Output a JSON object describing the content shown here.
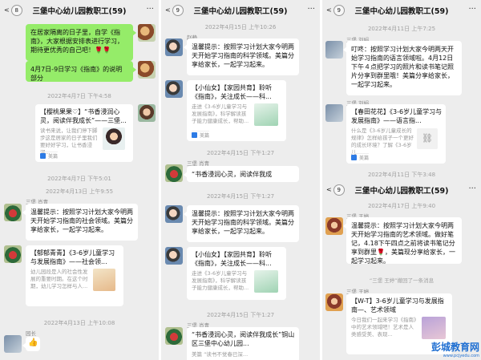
{
  "group_title": "三堡中心幼儿园教职工(59)",
  "colors": {
    "accent_green": "#95ec69",
    "panel_bg": "#ededed",
    "link_blue": "#576b95"
  },
  "panel1": {
    "back_count": "8",
    "msg1": "在居家隔离的日子里，自学《指南》，大家根据安排表进行学习，期待更优秀的自己吧！🌹🌹",
    "msg2": "4月7日-9日学习《指南》的说明部分",
    "ts1": "2022年4月7日 下午4:58",
    "card1_title": "【樱桃果果♡】“书香浸润心灵，阅读伴我成长”——三堡...",
    "card1_desc": "读书来说，让我们停下脚步这是居家的日子里我们要好好学习，让书香浸润...",
    "card1_source": "美篇",
    "ts2": "2022年4月7日 下午5:01",
    "ts3": "2022年4月13日 上午9:55",
    "sender1": "三堡 肖青",
    "msg3": "温馨提示：按照学习计划大家今明两天开始学习指南的社会领域。美篇分享给家长，一起学习起来。",
    "card2_title": "【郁郁青青】《3-6岁儿童学习与发展指南》——社会领...",
    "card2_desc": "幼儿园段是人的社会性发展的重要时期。在这个时期，幼儿学习怎样与人...",
    "ts4": "2022年4月13日 上午10:08",
    "sender2": "园长"
  },
  "panel2": {
    "back_count": "9",
    "ts1": "2022年4月15日 上午10:26",
    "sender1": "赵静",
    "msg1": "温馨提示：按照学习计划大家今明两天开始学习指南的科学领域。美篇分享给家长，一起学习起来。",
    "card1_title": "【小仙女】【家园共育】聆听《指南》，关注成长——科...",
    "card1_desc": "走进《3-6岁儿童学习与发展指南》，科学解读孩子能力健康成长，帮助...",
    "card1_source": "美篇",
    "ts2": "2022年4月15日 下午1:27",
    "sender2": "三堡 肖青",
    "msg2": "“书香浸润心灵，阅读伴我成",
    "ts3": "2022年4月15日 下午1:27",
    "msg3": "温馨提示：按照学习计划大家今明两天开始学习指南的科学领域。美篇分享给家长，一起学习起来。",
    "card2_title": "【小仙女】【家园共育】聆听《指南》，关注成长——科...",
    "card2_desc": "走进《3-6岁儿童学习与发展指南》，科学解读孩子能力健康成长，帮助...",
    "ts4": "2022年4月15日 下午1:27",
    "sender3": "三堡 肖青",
    "msg4": "“书香浸润心灵，阅读伴我成长”铜山区三堡中心幼儿园...",
    "card3_desc": "美篇 “读书不觉春已深..."
  },
  "panel3": {
    "back_count": "9",
    "ts1": "2022年4月11日 上午7:25",
    "sender1": "三堡 刘娟",
    "msg1": "叮咚：按照学习计划大家今明两天开始学习指南的语言领域啦。4月12日下午４点把学习的照片和读书笔记照片分享到群里哦！美篇分享给家长，一起学习起来。",
    "sender2": "三堡 刘娟",
    "card1_title": "【春田花花】《3-6岁儿童学习与发展指南》——语言指...",
    "card1_desc": "什么是《3-6岁儿童成长的规律》怎样给孩子一个更好的成长环境？了解《3-6岁儿...",
    "card1_source": "美篇",
    "ts2": "2022年4月11日 下午3:48",
    "back_count2": "9",
    "group_title2": "三堡中心幼儿园教职工(59)",
    "ts3": "2022年4月17日 上午9:40",
    "sender3": "三堡 王婷",
    "msg2": "温馨提示：按照学习计划大家今明两天开始学习指南的艺术领域。做好笔记，4.18下午四点之前将读书笔记分享到群里🌹，美篇现分享给家长，一起学习起来。",
    "sysmsg": "“三堡 王婷”撤回了一条消息",
    "sender4": "三堡 王婷",
    "card2_title": "【W-T】3-6岁儿童学习与发展指南—、艺术领域",
    "card2_desc": "今日我们一起来学习《指南》中的艺术领域吧！艺术是人类感受美、表现...",
    "watermark": "彭城教育网",
    "watermark_url": "www.pcjyedu.com"
  }
}
